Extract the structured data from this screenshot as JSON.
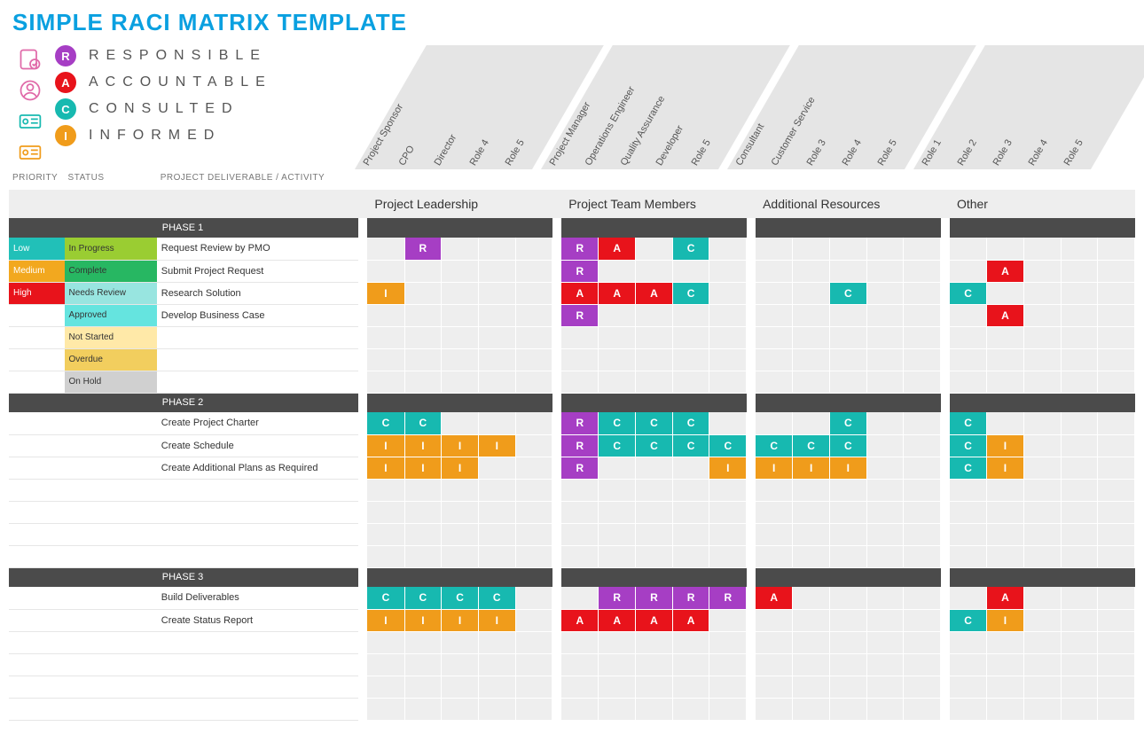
{
  "title": "SIMPLE RACI MATRIX TEMPLATE",
  "legend": {
    "R": "RESPONSIBLE",
    "A": "ACCOUNTABLE",
    "C": "CONSULTED",
    "I": "INFORMED"
  },
  "col_headers": {
    "priority": "PRIORITY",
    "status": "STATUS",
    "activity": "PROJECT DELIVERABLE / ACTIVITY"
  },
  "role_groups": [
    {
      "name": "Project Leadership",
      "roles": [
        "Project Sponsor",
        "CPO",
        "Director",
        "Role 4",
        "Role 5"
      ]
    },
    {
      "name": "Project Team Members",
      "roles": [
        "Project Manager",
        "Operations Engineer",
        "Quality Assurance",
        "Developer",
        "Role 5"
      ]
    },
    {
      "name": "Additional Resources",
      "roles": [
        "Consultant",
        "Customer Service",
        "Role 3",
        "Role 4",
        "Role 5"
      ]
    },
    {
      "name": "Other",
      "roles": [
        "Role 1",
        "Role 2",
        "Role 3",
        "Role 4",
        "Role 5"
      ]
    }
  ],
  "phases": [
    {
      "name": "PHASE 1",
      "rows": [
        {
          "priority": "Low",
          "status": "In Progress",
          "activity": "Request Review by PMO",
          "cells": [
            "",
            "R",
            "",
            "",
            "",
            "R",
            "A",
            "",
            "C",
            "",
            "",
            "",
            "",
            "",
            "",
            "",
            "",
            "",
            "",
            ""
          ]
        },
        {
          "priority": "Medium",
          "status": "Complete",
          "activity": "Submit Project Request",
          "cells": [
            "",
            "",
            "",
            "",
            "",
            "R",
            "",
            "",
            "",
            "",
            "",
            "",
            "",
            "",
            "",
            "",
            "A",
            "",
            "",
            ""
          ]
        },
        {
          "priority": "High",
          "status": "Needs Review",
          "activity": "Research Solution",
          "cells": [
            "I",
            "",
            "",
            "",
            "",
            "A",
            "A",
            "A",
            "C",
            "",
            "",
            "",
            "C",
            "",
            "",
            "C",
            "",
            "",
            "",
            ""
          ]
        },
        {
          "priority": "",
          "status": "Approved",
          "activity": "Develop Business Case",
          "cells": [
            "",
            "",
            "",
            "",
            "",
            "R",
            "",
            "",
            "",
            "",
            "",
            "",
            "",
            "",
            "",
            "",
            "A",
            "",
            "",
            ""
          ]
        },
        {
          "priority": "",
          "status": "Not Started",
          "activity": "",
          "cells": [
            "",
            "",
            "",
            "",
            "",
            "",
            "",
            "",
            "",
            "",
            "",
            "",
            "",
            "",
            "",
            "",
            "",
            "",
            "",
            ""
          ]
        },
        {
          "priority": "",
          "status": "Overdue",
          "activity": "",
          "cells": [
            "",
            "",
            "",
            "",
            "",
            "",
            "",
            "",
            "",
            "",
            "",
            "",
            "",
            "",
            "",
            "",
            "",
            "",
            "",
            ""
          ]
        },
        {
          "priority": "",
          "status": "On Hold",
          "activity": "",
          "cells": [
            "",
            "",
            "",
            "",
            "",
            "",
            "",
            "",
            "",
            "",
            "",
            "",
            "",
            "",
            "",
            "",
            "",
            "",
            "",
            ""
          ]
        }
      ],
      "blank_rows_after": 0
    },
    {
      "name": "PHASE 2",
      "rows": [
        {
          "priority": "",
          "status": "",
          "activity": "Create Project Charter",
          "cells": [
            "C",
            "C",
            "",
            "",
            "",
            "R",
            "C",
            "C",
            "C",
            "",
            "",
            "",
            "C",
            "",
            "",
            "C",
            "",
            "",
            "",
            ""
          ]
        },
        {
          "priority": "",
          "status": "",
          "activity": "Create Schedule",
          "cells": [
            "I",
            "I",
            "I",
            "I",
            "",
            "R",
            "C",
            "C",
            "C",
            "C",
            "C",
            "C",
            "C",
            "",
            "",
            "C",
            "I",
            "",
            "",
            ""
          ]
        },
        {
          "priority": "",
          "status": "",
          "activity": "Create Additional Plans as Required",
          "cells": [
            "I",
            "I",
            "I",
            "",
            "",
            "R",
            "",
            "",
            "",
            "I",
            "I",
            "I",
            "I",
            "",
            "",
            "C",
            "I",
            "",
            "",
            ""
          ]
        }
      ],
      "blank_rows_after": 4
    },
    {
      "name": "PHASE 3",
      "rows": [
        {
          "priority": "",
          "status": "",
          "activity": "Build Deliverables",
          "cells": [
            "C",
            "C",
            "C",
            "C",
            "",
            "",
            "R",
            "R",
            "R",
            "R",
            "A",
            "",
            "",
            "",
            "",
            "",
            "A",
            "",
            "",
            ""
          ]
        },
        {
          "priority": "",
          "status": "",
          "activity": "Create Status Report",
          "cells": [
            "I",
            "I",
            "I",
            "I",
            "",
            "A",
            "A",
            "A",
            "A",
            "",
            "",
            "",
            "",
            "",
            "",
            "C",
            "I",
            "",
            "",
            ""
          ]
        }
      ],
      "blank_rows_after": 4
    }
  ],
  "chart_data": {
    "type": "table",
    "description": "RACI responsibility matrix mapping activities to roles with R/A/C/I codes",
    "legend": {
      "R": "Responsible",
      "A": "Accountable",
      "C": "Consulted",
      "I": "Informed"
    }
  }
}
